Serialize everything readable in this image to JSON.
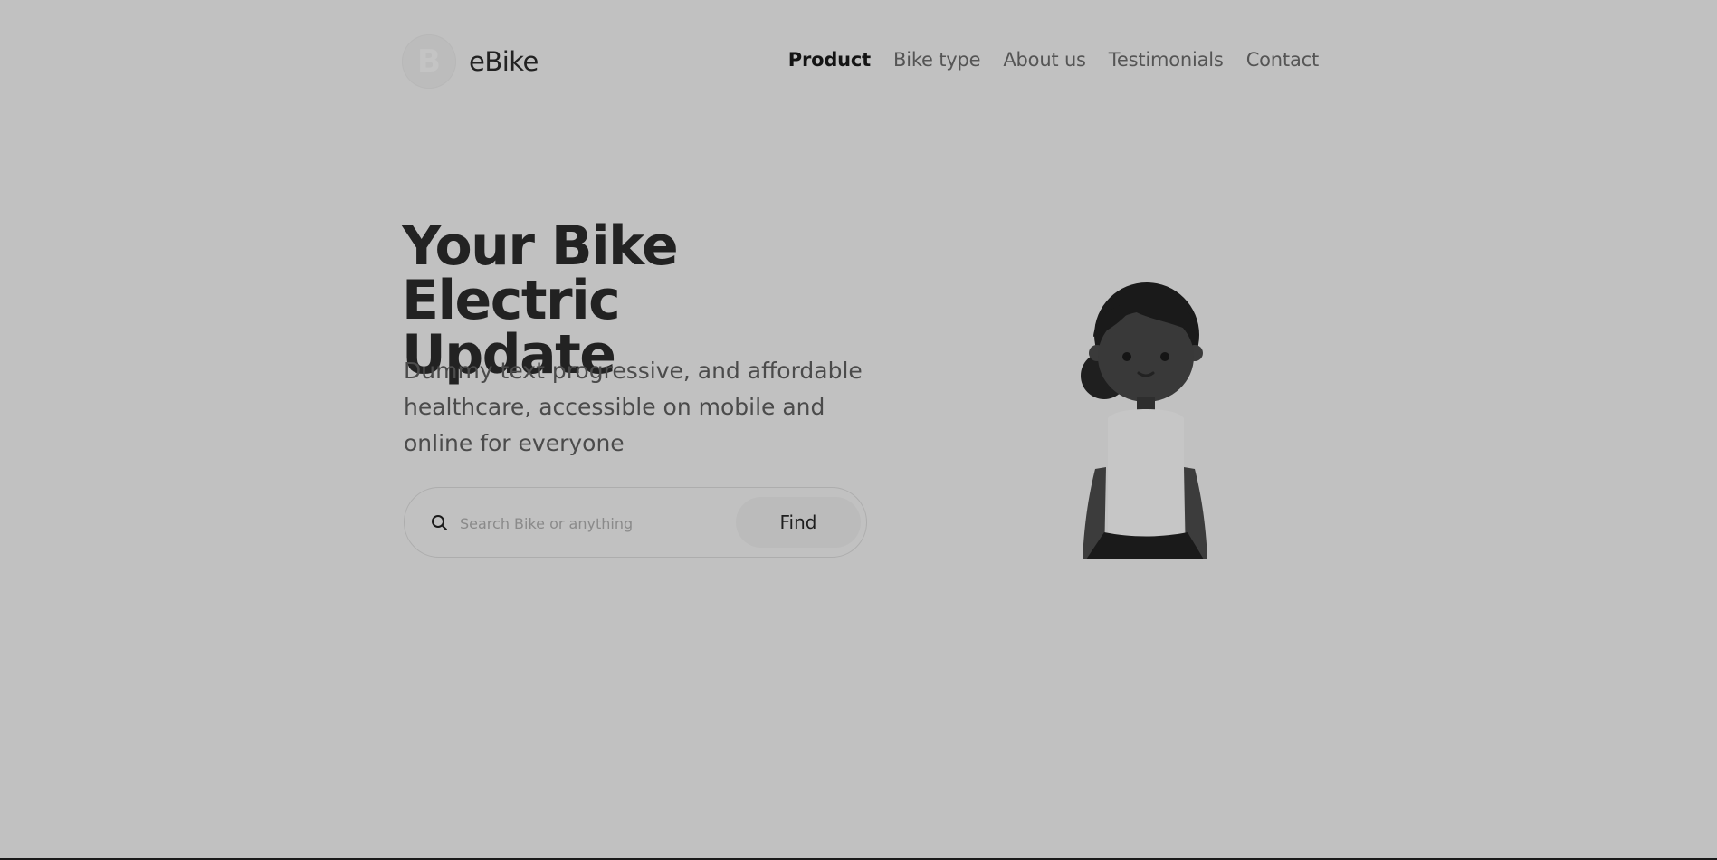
{
  "header": {
    "logo_letter": "B",
    "brand": "eBike",
    "nav": [
      {
        "label": "Product",
        "active": true
      },
      {
        "label": "Bike type",
        "active": false
      },
      {
        "label": "About us",
        "active": false
      },
      {
        "label": "Testimonials",
        "active": false
      },
      {
        "label": "Contact",
        "active": false
      }
    ]
  },
  "hero": {
    "title_line1": "Your Bike Electric",
    "title_line2": "Update",
    "subtitle_line1": "Dummy text progressive, and affordable",
    "subtitle_line2": "healthcare, accessible on mobile and",
    "subtitle_line3": "online for everyone"
  },
  "search": {
    "placeholder": "Search Bike or anything",
    "button_label": "Find"
  },
  "colors": {
    "background": "#c1c1c1",
    "text_primary": "#222222",
    "text_secondary": "#555555"
  },
  "icons": {
    "search": "search-icon",
    "illustration": "person-illustration"
  }
}
